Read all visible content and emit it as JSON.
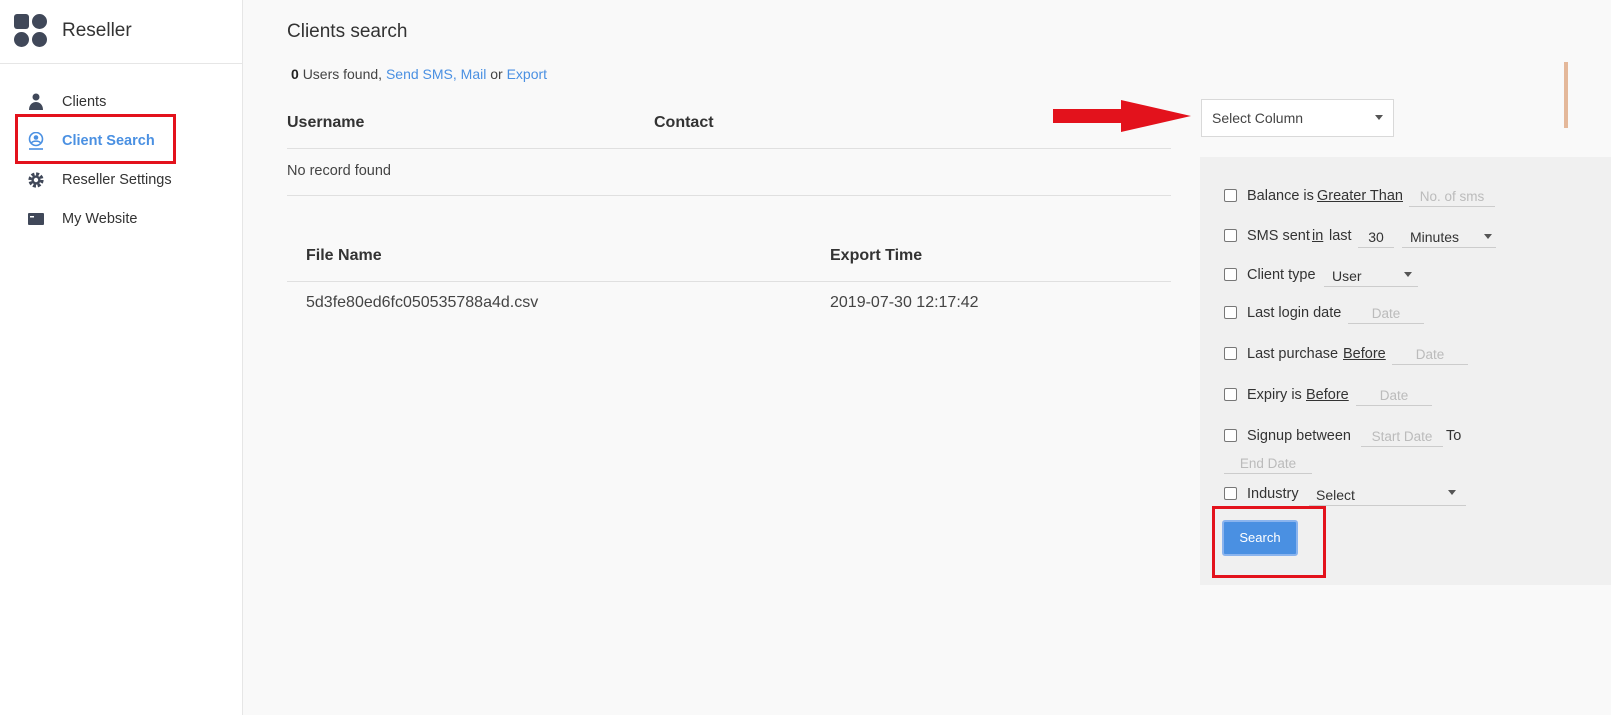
{
  "sidebar": {
    "brand": "Reseller",
    "items": [
      {
        "label": "Clients",
        "icon": "users-icon"
      },
      {
        "label": "Client Search",
        "icon": "user-search-icon",
        "active": true
      },
      {
        "label": "Reseller Settings",
        "icon": "gear-icon"
      },
      {
        "label": "My Website",
        "icon": "browser-window-icon"
      }
    ]
  },
  "main": {
    "title": "Clients search",
    "results": {
      "count": "0",
      "text_found": "Users found,",
      "link_send_sms": "Send SMS,",
      "link_mail": "Mail",
      "text_or": "or",
      "link_export": "Export"
    },
    "clients_table": {
      "headers": [
        "Username",
        "Contact"
      ],
      "empty_message": "No record found"
    },
    "export_table": {
      "headers": [
        "File Name",
        "Export Time"
      ],
      "rows": [
        {
          "file_name": "5d3fe80ed6fc050535788a4d.csv",
          "export_time": "2019-07-30 12:17:42"
        }
      ]
    }
  },
  "select_column": {
    "label": "Select Column"
  },
  "filters": {
    "balance": {
      "prefix": "Balance is",
      "operator": "Greater Than",
      "placeholder": "No. of sms"
    },
    "sms_sent": {
      "prefix": "SMS sent",
      "in": "in",
      "last": "last",
      "value": "30",
      "unit": "Minutes"
    },
    "client_type": {
      "prefix": "Client type",
      "value": "User"
    },
    "last_login": {
      "prefix": "Last login date",
      "placeholder": "Date"
    },
    "last_purchase": {
      "prefix": "Last purchase",
      "operator": "Before",
      "placeholder": "Date"
    },
    "expiry": {
      "prefix": "Expiry is",
      "operator": "Before",
      "placeholder": "Date"
    },
    "signup": {
      "prefix": "Signup between",
      "start_placeholder": "Start Date",
      "to": "To",
      "end_placeholder": "End Date"
    },
    "industry": {
      "prefix": "Industry",
      "value": "Select"
    },
    "search_button": "Search"
  },
  "colors": {
    "accent": "#4a90e2",
    "highlight": "#e3121c"
  }
}
